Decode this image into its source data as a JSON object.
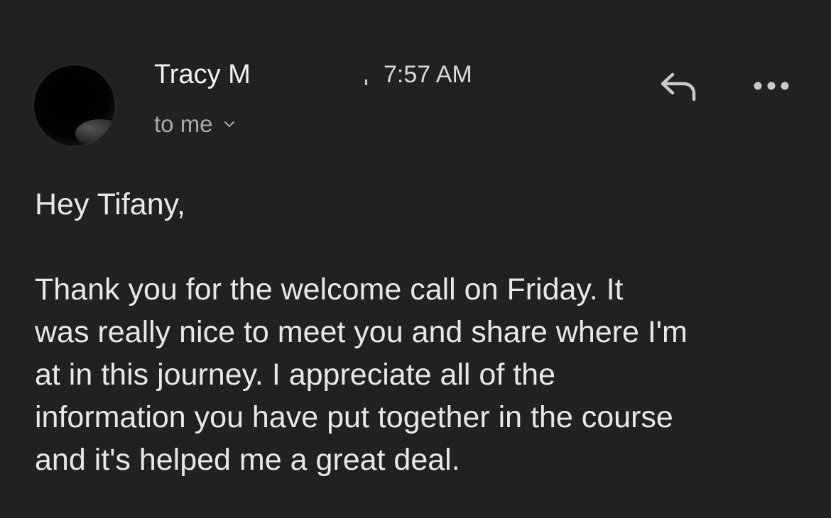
{
  "email": {
    "sender_name": "Tracy M",
    "time": "7:57 AM",
    "recipient_label": "to me",
    "greeting": "Hey Tifany,",
    "body_lines": [
      "Thank you for the welcome call on Friday.  It",
      "was really nice to meet you and share where I'm",
      "at in this journey. I appreciate all of the",
      "information you have put together in the course",
      "and it's helped me a great deal."
    ]
  },
  "icons": {
    "reply": "reply-icon",
    "more": "more-horizontal-icon",
    "chevron": "chevron-down-icon"
  },
  "colors": {
    "background": "#212124",
    "text": "#e8e8eb",
    "secondary_text": "#a9a9ae",
    "icon": "#c9c9cd"
  }
}
